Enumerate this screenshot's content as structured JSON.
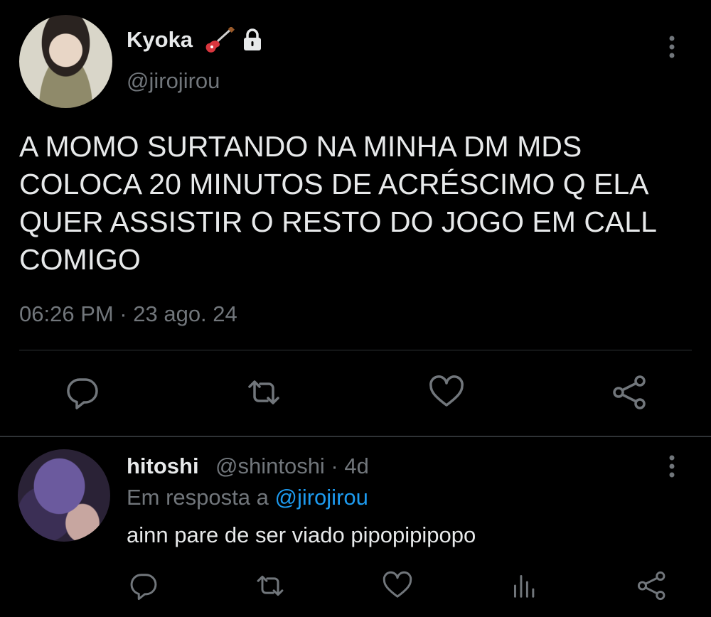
{
  "tweet": {
    "display_name": "Kyoka",
    "handle": "@jirojirou",
    "text": "A MOMO SURTANDO NA MINHA DM MDS\nCOLOCA 20 MINUTOS DE ACRÉSCIMO Q ELA\nQUER ASSISTIR O RESTO DO JOGO EM CALL\nCOMIGO",
    "timestamp": "06:26 PM · 23 ago. 24",
    "badges": [
      "guitar-icon",
      "lock-icon"
    ],
    "actions": [
      "reply-icon",
      "retweet-icon",
      "like-icon",
      "share-icon"
    ]
  },
  "reply": {
    "display_name": "hitoshi",
    "handle_time": "@shintoshi · 4d",
    "reply_prefix": "Em resposta a ",
    "reply_mention": "@jirojirou",
    "text": "ainn pare de ser viado pipopipipopo",
    "actions": [
      "reply-icon",
      "retweet-icon",
      "like-icon",
      "views-icon",
      "share-icon"
    ]
  },
  "colors": {
    "background": "#000000",
    "text_primary": "#e7e9ea",
    "text_secondary": "#71767b",
    "accent": "#1d9bf0",
    "divider": "#2f3336"
  }
}
